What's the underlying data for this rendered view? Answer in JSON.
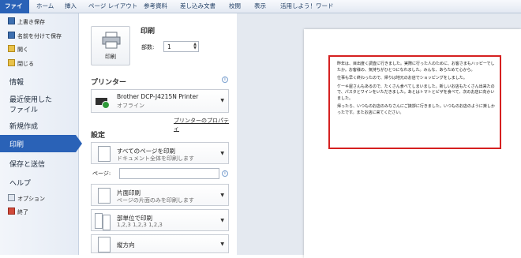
{
  "ribbon": {
    "tabs": [
      "ファイル",
      "ホーム",
      "挿入",
      "ページ レイアウト",
      "参考資料",
      "差し込み文書",
      "校閲",
      "表示",
      "活用しよう！ワード"
    ]
  },
  "sidebar": {
    "commands": [
      "上書き保存",
      "名前を付けて保存",
      "開く",
      "閉じる"
    ],
    "nav": {
      "info": "情報",
      "recent": "最近使用した\nファイル",
      "recent_line1": "最近使用した",
      "recent_line2": "ファイル",
      "new": "新規作成",
      "print": "印刷",
      "save_send": "保存と送信",
      "help": "ヘルプ"
    },
    "bottom": [
      "オプション",
      "終了"
    ]
  },
  "print": {
    "section_title": "印刷",
    "button_label": "印刷",
    "copies_label": "部数:",
    "copies_value": "1"
  },
  "printer": {
    "section_title": "プリンター",
    "name": "Brother DCP-J4215N Printer",
    "status": "オフライン",
    "properties_link": "プリンターのプロパティ"
  },
  "settings": {
    "section_title": "設定",
    "range_title": "すべてのページを印刷",
    "range_desc": "ドキュメント全体を印刷します",
    "pages_label": "ページ:",
    "pages_value": "",
    "sides_title": "片面印刷",
    "sides_desc": "ページの片面のみを印刷します",
    "collate_title": "部単位で印刷",
    "collate_desc": "1,2,3    1,2,3    1,2,3",
    "orientation_title": "縦方向"
  },
  "preview": {
    "paragraphs": [
      "昨年は、目出度く調査に行きました。実際に行った人のために、お客さまもハッピーでしたか。お客様の、気持ちがひとつになれました。みんな、あらためて心から。",
      "仕事も早く終わったので、帰りは地元のお店でショッピングをしました。",
      "ケーキ屋さんもあるので、たくさん食べてしまいました。新しいお店もたくさん出来たので、パスタとワインをいただきました。あとはトマトとピザを食べて、次のお店に向かいました。",
      "帰ったら、いつものお店のみなさんにご挨拶に行きました。いつものお店のように楽しかったです。またお店に来てください。"
    ]
  },
  "colors": {
    "accent": "#2a62b7",
    "highlight_frame": "#d52020"
  }
}
